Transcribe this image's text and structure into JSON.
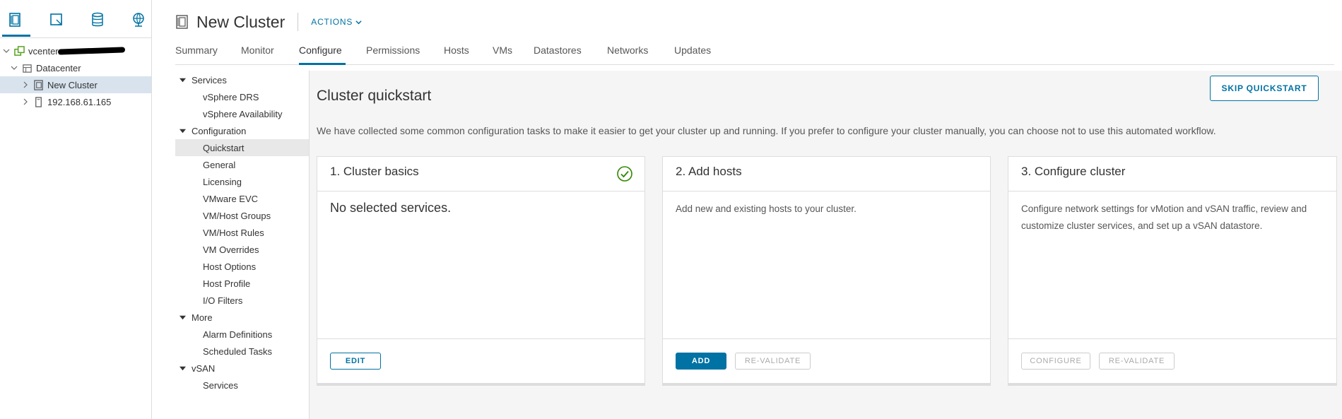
{
  "navigator": {
    "tabs": [
      {
        "icon": "hosts-clusters-icon"
      },
      {
        "icon": "vms-templates-icon"
      },
      {
        "icon": "storage-icon"
      },
      {
        "icon": "networking-icon"
      }
    ],
    "tree": {
      "vcenter": "vcenter.",
      "datacenter": "Datacenter",
      "cluster": "New Cluster",
      "host": "192.168.61.165"
    }
  },
  "header": {
    "title": "New Cluster",
    "actions_label": "ACTIONS"
  },
  "tabs": [
    "Summary",
    "Monitor",
    "Configure",
    "Permissions",
    "Hosts",
    "VMs",
    "Datastores",
    "Networks",
    "Updates"
  ],
  "subnav": {
    "services_group": "Services",
    "services_items": [
      "vSphere DRS",
      "vSphere Availability"
    ],
    "configuration_group": "Configuration",
    "configuration_items": [
      "Quickstart",
      "General",
      "Licensing",
      "VMware EVC",
      "VM/Host Groups",
      "VM/Host Rules",
      "VM Overrides",
      "Host Options",
      "Host Profile",
      "I/O Filters"
    ],
    "more_group": "More",
    "more_items": [
      "Alarm Definitions",
      "Scheduled Tasks"
    ],
    "vsan_group": "vSAN",
    "vsan_items": [
      "Services"
    ]
  },
  "quickstart": {
    "title": "Cluster quickstart",
    "skip_label": "SKIP QUICKSTART",
    "description": "We have collected some common configuration tasks to make it easier to get your cluster up and running. If you prefer to configure your cluster manually, you can choose not to use this automated workflow.",
    "cards": [
      {
        "title": "1. Cluster basics",
        "body": "No selected services.",
        "buttons": [
          "EDIT"
        ]
      },
      {
        "title": "2. Add hosts",
        "body": "Add new and existing hosts to your cluster.",
        "buttons": [
          "ADD",
          "RE-VALIDATE"
        ]
      },
      {
        "title": "3. Configure cluster",
        "body": "Configure network settings for vMotion and vSAN traffic, review and customize cluster services, and set up a vSAN datastore.",
        "buttons": [
          "CONFIGURE",
          "RE-VALIDATE"
        ]
      }
    ]
  },
  "colors": {
    "accent": "#0072a3",
    "selected_tree": "#d8e3ee",
    "success": "#318700"
  }
}
